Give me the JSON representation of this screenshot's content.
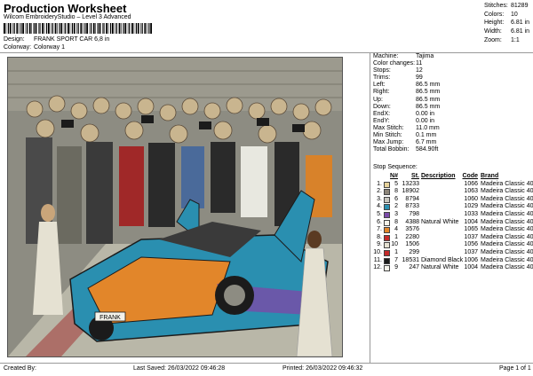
{
  "header": {
    "title": "Production Worksheet",
    "software": "Wilcom EmbroideryStudio – Level 3 Advanced",
    "design_label": "Design:",
    "design_value": "FRANK SPORT CAR 6,8 in",
    "colorway_label": "Colorway:",
    "colorway_value": "Colorway 1"
  },
  "summary": [
    {
      "label": "Stitches:",
      "value": "81289"
    },
    {
      "label": "Colors:",
      "value": "10"
    },
    {
      "label": "Height:",
      "value": "6.81 in"
    },
    {
      "label": "Width:",
      "value": "6.81 in"
    },
    {
      "label": "Zoom:",
      "value": "1:1"
    }
  ],
  "details": [
    {
      "label": "Machine:",
      "value": "Tajima"
    },
    {
      "label": "Color changes:",
      "value": "11"
    },
    {
      "label": "Stops:",
      "value": "12"
    },
    {
      "label": "Trims:",
      "value": "99"
    },
    {
      "label": "Left:",
      "value": "86.5 mm"
    },
    {
      "label": "Right:",
      "value": "86.5 mm"
    },
    {
      "label": "Up:",
      "value": "86.5 mm"
    },
    {
      "label": "Down:",
      "value": "86.5 mm"
    },
    {
      "label": "EndX:",
      "value": "0.00 in"
    },
    {
      "label": "EndY:",
      "value": "0.00 in"
    },
    {
      "label": "Max Stitch:",
      "value": "11.0 mm"
    },
    {
      "label": "Min Stitch:",
      "value": "0.1 mm"
    },
    {
      "label": "Max Jump:",
      "value": "6.7 mm"
    },
    {
      "label": "Total Bobbin:",
      "value": "584.90ft"
    }
  ],
  "sequence": {
    "title": "Stop Sequence:",
    "headers": {
      "n": "N#",
      "st": "St.",
      "desc": "Description",
      "code": "Code",
      "brand": "Brand"
    },
    "rows": [
      {
        "n": "1.",
        "nn": "5",
        "st": "13233",
        "desc": "",
        "code": "1066",
        "brand": "Madeira Classic 40",
        "color": "#e7d39b"
      },
      {
        "n": "2.",
        "nn": "8",
        "st": "18902",
        "desc": "",
        "code": "1063",
        "brand": "Madeira Classic 40",
        "color": "#8c8579"
      },
      {
        "n": "3.",
        "nn": "6",
        "st": "8794",
        "desc": "",
        "code": "1060",
        "brand": "Madeira Classic 40",
        "color": "#c8c6be"
      },
      {
        "n": "4.",
        "nn": "2",
        "st": "8733",
        "desc": "",
        "code": "1029",
        "brand": "Madeira Classic 40",
        "color": "#2a8fb0"
      },
      {
        "n": "5.",
        "nn": "3",
        "st": "798",
        "desc": "",
        "code": "1033",
        "brand": "Madeira Classic 40",
        "color": "#7a4aa8"
      },
      {
        "n": "6.",
        "nn": "8",
        "st": "4388",
        "desc": "Natural White",
        "code": "1004",
        "brand": "Madeira Classic 40",
        "color": "#f4f2ea"
      },
      {
        "n": "7.",
        "nn": "4",
        "st": "3576",
        "desc": "",
        "code": "1065",
        "brand": "Madeira Classic 40",
        "color": "#e2862a"
      },
      {
        "n": "8.",
        "nn": "1",
        "st": "2280",
        "desc": "",
        "code": "1037",
        "brand": "Madeira Classic 40",
        "color": "#c42a2a"
      },
      {
        "n": "9.",
        "nn": "10",
        "st": "1506",
        "desc": "",
        "code": "1056",
        "brand": "Madeira Classic 40",
        "color": "#e5e1d2"
      },
      {
        "n": "10.",
        "nn": "1",
        "st": "299",
        "desc": "",
        "code": "1037",
        "brand": "Madeira Classic 40",
        "color": "#c42a2a"
      },
      {
        "n": "11.",
        "nn": "7",
        "st": "18531",
        "desc": "Diamond Black",
        "code": "1006",
        "brand": "Madeira Classic 40",
        "color": "#1b1b1b"
      },
      {
        "n": "12.",
        "nn": "9",
        "st": "247",
        "desc": "Natural White",
        "code": "1004",
        "brand": "Madeira Classic 40",
        "color": "#f4f2ea"
      }
    ]
  },
  "footer": {
    "created_by": "Created By:",
    "last_saved": "Last Saved: 26/03/2022 09:46:28",
    "printed": "Printed: 26/03/2022 09:46:32",
    "page": "Page 1 of 1"
  },
  "plate_text": "FRANK"
}
